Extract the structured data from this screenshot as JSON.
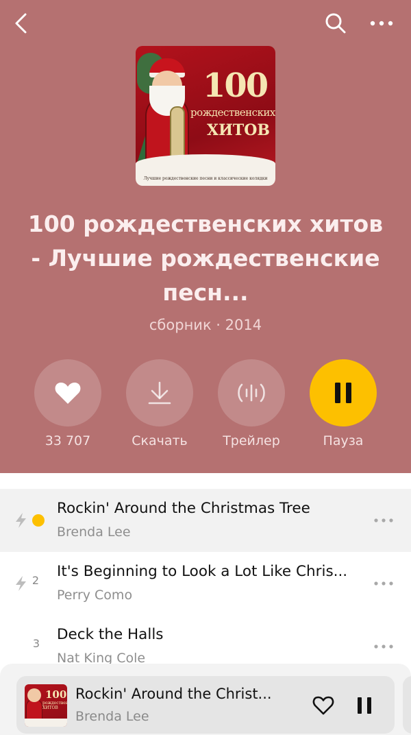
{
  "topbar": {
    "back_icon": "chevron-left-icon",
    "search_icon": "search-icon",
    "more_icon": "more-dots-icon"
  },
  "cover": {
    "number": "100",
    "line2": "рождественских",
    "line3": "ХИТОВ",
    "fine": "Лучшие рождественские песни и классические колядки"
  },
  "album": {
    "title": "100 рождественских хитов - Лучшие рождественские песн...",
    "meta": "сборник · 2014"
  },
  "actions": [
    {
      "icon": "heart-icon",
      "label": "33 707"
    },
    {
      "icon": "download-icon",
      "label": "Скачать"
    },
    {
      "icon": "trailer-icon",
      "label": "Трейлер"
    },
    {
      "icon": "pause-icon",
      "label": "Пауза"
    }
  ],
  "tracks": [
    {
      "index": "",
      "title": "Rockin' Around the Christmas Tree",
      "artist": "Brenda Lee",
      "playing": true,
      "lightning": true
    },
    {
      "index": "2",
      "title": "It's Beginning to Look a Lot Like Chris...",
      "artist": "Perry Como",
      "playing": false,
      "lightning": true
    },
    {
      "index": "3",
      "title": "Deck the Halls",
      "artist": "Nat King Cole",
      "playing": false,
      "lightning": false
    }
  ],
  "mini_player": {
    "cover_number": "100",
    "cover_text": "рождественских ХИТОВ",
    "title": "Rockin' Around the Christ...",
    "artist": "Brenda Lee"
  },
  "colors": {
    "header_bg": "#b57171",
    "accent": "#fdc000"
  }
}
